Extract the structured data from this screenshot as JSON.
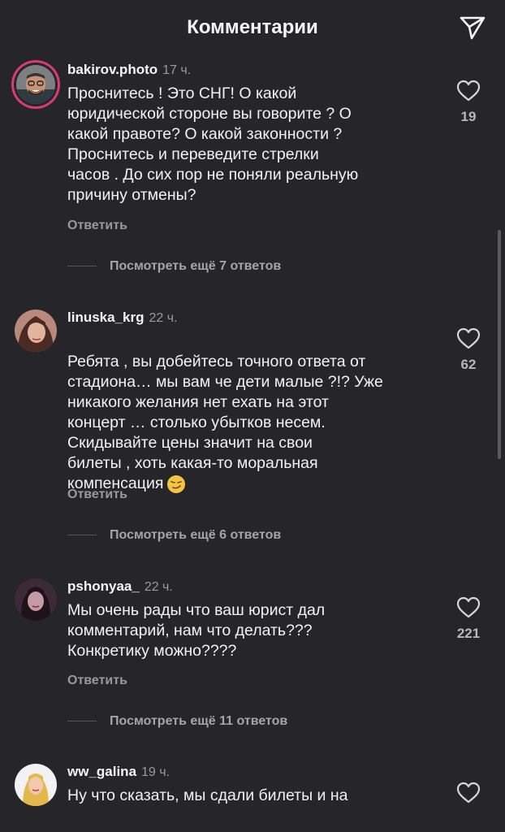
{
  "header": {
    "title": "Комментарии",
    "send_icon": "send-icon"
  },
  "comments": [
    {
      "username": "bakirov.photo",
      "time": "17 ч.",
      "text": "Проснитесь ! Это СНГ! О какой\nюридической стороне вы говорите ? О\nкакой правоте? О какой законности ?\nПроснитесь и переведите стрелки\nчасов . До сих пор не поняли реальную\nпричину отмены?",
      "likes": "19",
      "reply_label": "Ответить",
      "view_replies": "Посмотреть ещё 7 ответов"
    },
    {
      "username": "linuska_krg",
      "time": "22 ч.",
      "text": "Ребята , вы добейтесь точного ответа от\nстадиона… мы вам че дети малые ?!? Уже\nникакого желания нет ехать на этот\nконцерт … столько убытков несем.\nСкидывайте цены значит на свои\nбилеты , хоть какая-то моральная\nкомпенсация",
      "likes": "62",
      "reply_label": "Ответить",
      "view_replies": "Посмотреть ещё 6 ответов"
    },
    {
      "username": "pshonyaa_",
      "time": "22 ч.",
      "text": "Мы очень рады что ваш юрист дал\nкомментарий, нам что делать???\nКонкретику можно????",
      "likes": "221",
      "reply_label": "Ответить",
      "view_replies": "Посмотреть ещё 11 ответов"
    },
    {
      "username": "ww_galina",
      "time": "19 ч.",
      "text": "Ну что сказать, мы сдали билеты и на"
    }
  ],
  "colors": {
    "background": "#26262a",
    "secondary_text": "#9a9a9e",
    "story_ring": "#d93b74"
  }
}
